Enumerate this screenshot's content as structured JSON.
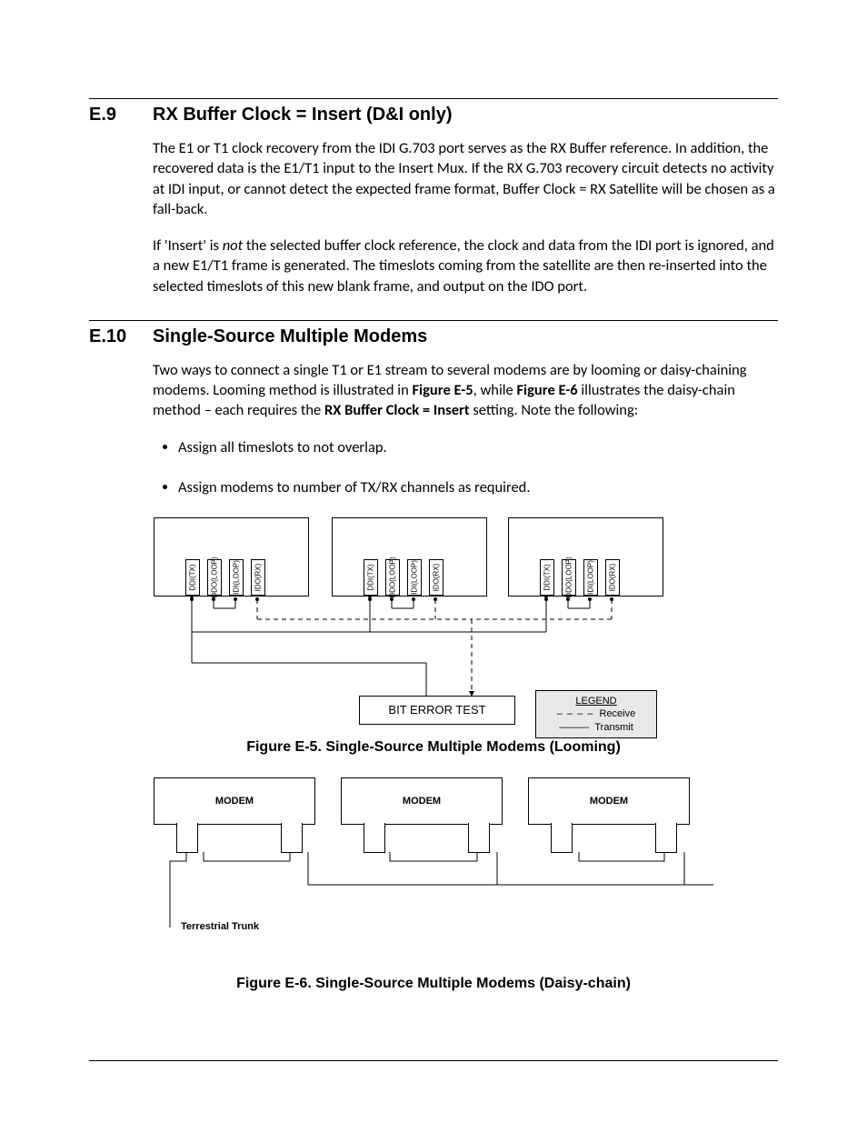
{
  "section1": {
    "num": "E.9",
    "title": "RX Buffer Clock = Insert (D&I only)",
    "p1": "The E1 or T1 clock recovery from the IDI G.703 port serves as the RX Buffer reference. In addition, the recovered data is the E1/T1 input to the Insert Mux. If the RX G.703 recovery circuit detects no activity at IDI input, or cannot detect the expected frame format, Buffer Clock = RX Satellite will be chosen as a fall-back.",
    "p2_pre": "If 'Insert' is ",
    "p2_em": "not",
    "p2_post": " the selected buffer clock reference, the clock and data from the IDI port is ignored, and a new E1/T1 frame is generated. The timeslots coming from the satellite are then re-inserted into the selected timeslots of this new blank frame, and output on the IDO port."
  },
  "section2": {
    "num": "E.10",
    "title": "Single-Source Multiple Modems",
    "intro_pre": "Two ways to connect a single T1 or E1 stream to several modems are by looming or daisy-chaining modems. Looming method is illustrated in ",
    "intro_b1": "Figure E-5",
    "intro_mid": ", while ",
    "intro_b2": "Figure E-6",
    "intro_mid2": " illustrates the daisy-chain method – each requires the ",
    "intro_b3": "RX Buffer Clock = Insert",
    "intro_post": " setting. Note the following:",
    "bullets": [
      "Assign all timeslots to not overlap.",
      "Assign modems to number of TX/RX channels as required."
    ]
  },
  "fig5": {
    "ports": [
      "DDI(TX)",
      "DDO(LOOP)",
      "IDI(LOOP)",
      "IDO(RX)"
    ],
    "bert": "BIT ERROR TEST",
    "legend": {
      "title": "LEGEND",
      "rx": "Receive",
      "tx": "Transmit",
      "dash": "– – – –",
      "solid": "———"
    },
    "caption": "Figure E-5. Single-Source Multiple Modems (Looming)"
  },
  "fig6": {
    "modem": "MODEM",
    "trunk": "Terrestrial Trunk",
    "caption": "Figure E-6. Single-Source Multiple Modems (Daisy-chain)"
  }
}
